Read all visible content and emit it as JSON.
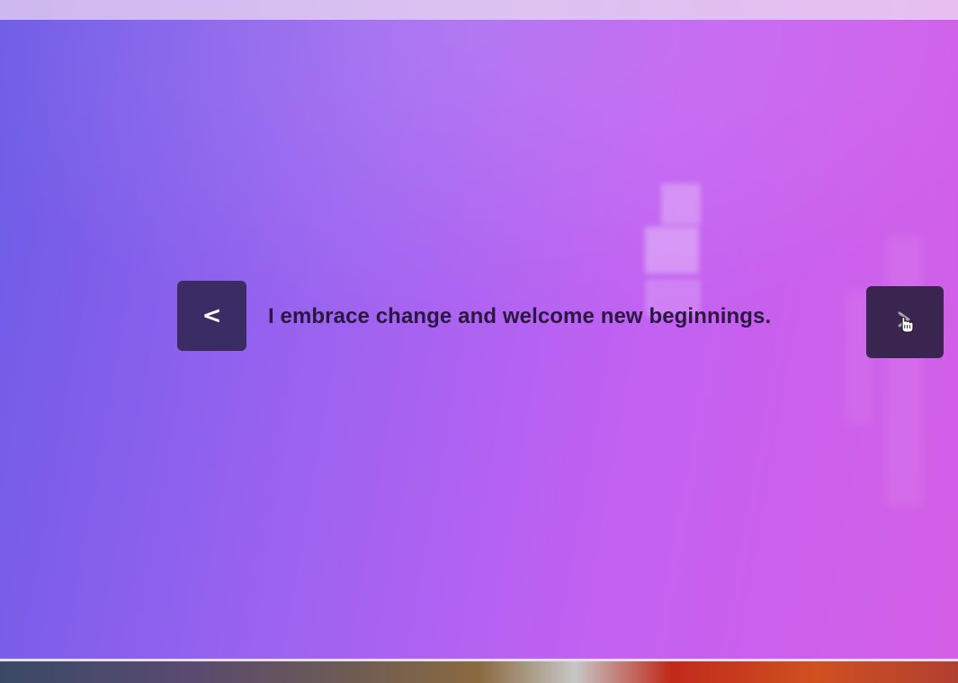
{
  "navigation": {
    "prev_glyph": "<",
    "prev_icon": "chevron-left-icon",
    "next_icon": "chevron-right-icon",
    "cursor_icon": "hand-pointer-icon"
  },
  "content": {
    "phrase": "I embrace change and welcome new beginnings."
  },
  "colors": {
    "background_start": "#6d5ce6",
    "background_end": "#d45fe6",
    "button_bg": "#3c2c66",
    "text": "#2a1742"
  }
}
